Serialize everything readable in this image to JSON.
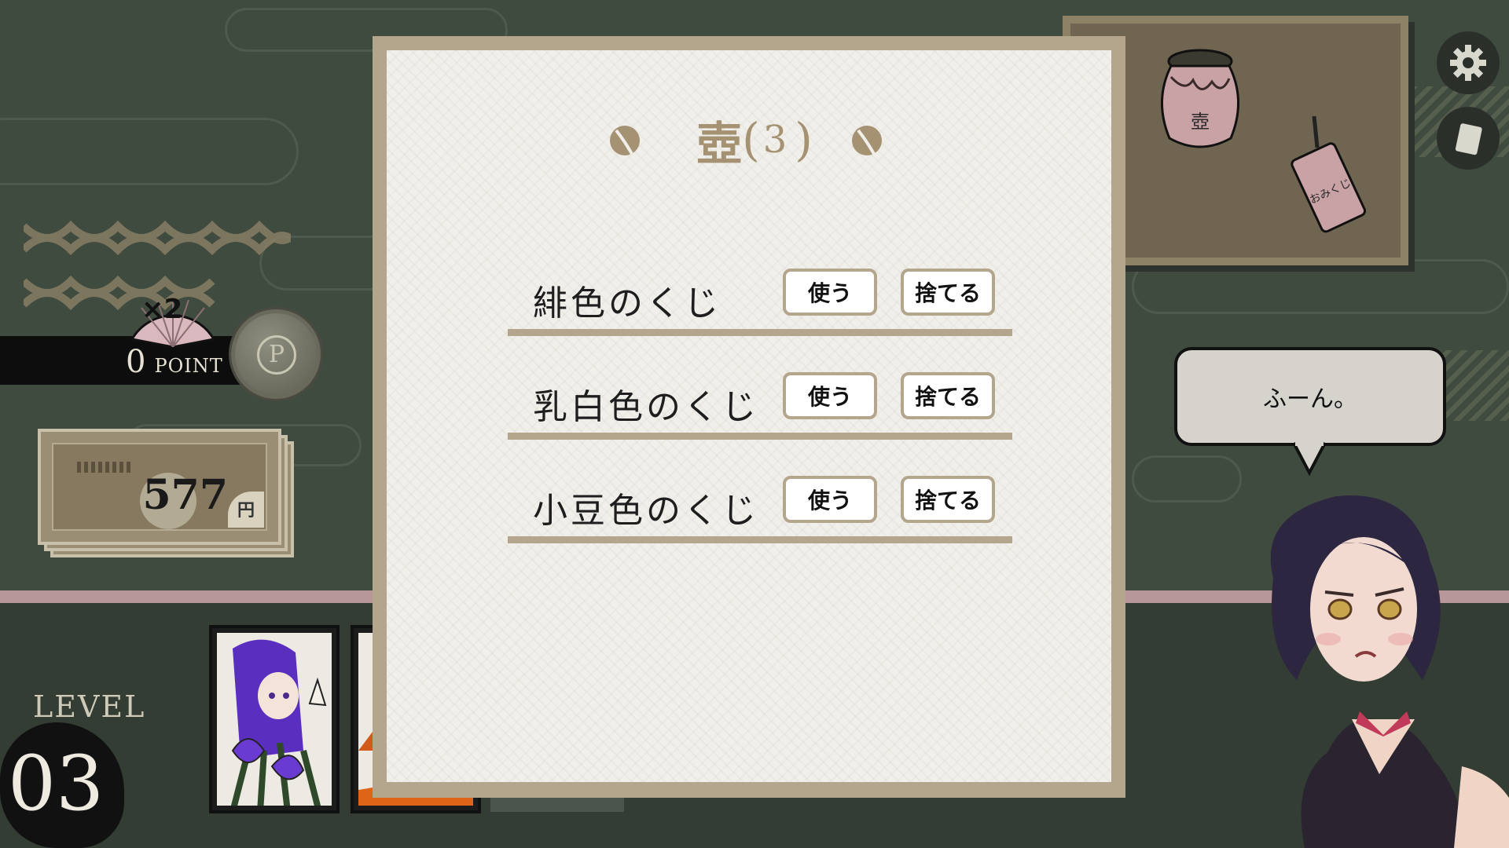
{
  "hud": {
    "multiplier": "×2",
    "points": "0",
    "points_unit": "POINT",
    "money": "577",
    "money_unit": "円",
    "level_label": "LEVEL",
    "level_number": "03"
  },
  "dialog": {
    "title": "壺",
    "count": "3",
    "items": [
      {
        "name": "緋色のくじ",
        "use_label": "使う",
        "discard_label": "捨てる"
      },
      {
        "name": "乳白色のくじ",
        "use_label": "使う",
        "discard_label": "捨てる"
      },
      {
        "name": "小豆色のくじ",
        "use_label": "使う",
        "discard_label": "捨てる"
      }
    ]
  },
  "tray": {
    "jar_label": "壺",
    "omikuji_label": "おみくじ"
  },
  "speech": {
    "text": "ふーん。"
  },
  "icons": {
    "settings": "gear-icon",
    "deck": "cards-icon",
    "coin": "point-coin-icon"
  },
  "colors": {
    "paper": "#f1efea",
    "frame": "#b3a68c",
    "title": "#a59273",
    "background": "#404b40"
  }
}
